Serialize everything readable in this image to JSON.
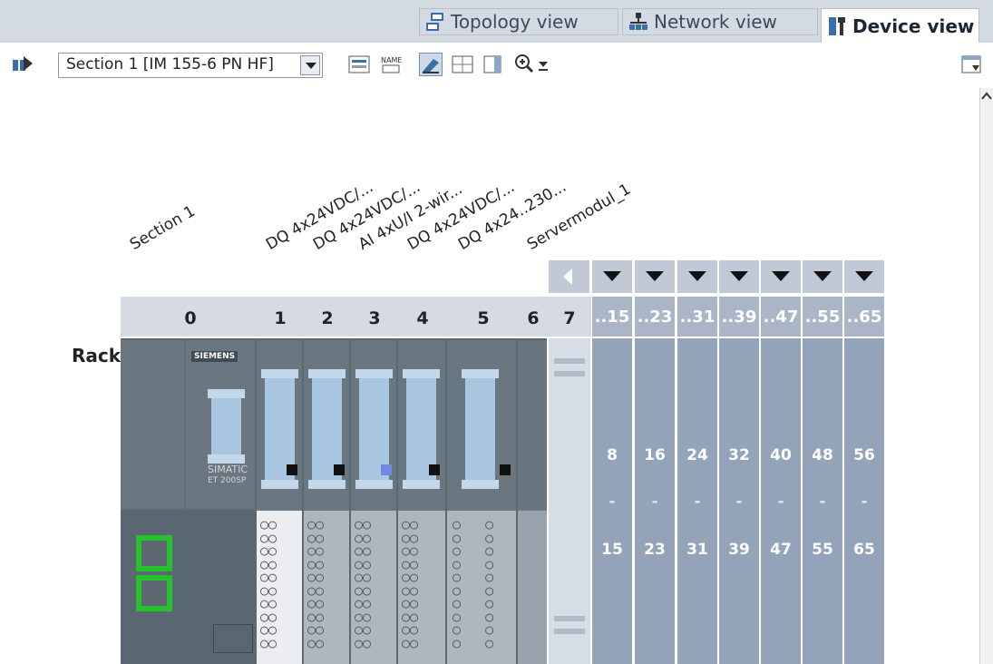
{
  "tabs": [
    {
      "label": "Topology view",
      "icon": "topology-icon",
      "active": false
    },
    {
      "label": "Network view",
      "icon": "network-icon",
      "active": false
    },
    {
      "label": "Device view",
      "icon": "device-icon",
      "active": true
    }
  ],
  "toolbar": {
    "section_select_value": "Section 1 [IM 155-6 PN HF]",
    "name_icon_text": "NAME"
  },
  "modules": [
    {
      "name": "Section 1",
      "slot": "0"
    },
    {
      "name": "DQ 4x24VDC/...",
      "slot": "1"
    },
    {
      "name": "DQ 4x24VDC/...",
      "slot": "2"
    },
    {
      "name": "AI 4xU/I 2-wir...",
      "slot": "3"
    },
    {
      "name": "DQ 4x24VDC/...",
      "slot": "4"
    },
    {
      "name": "DQ 4x24..230...",
      "slot": "5"
    },
    {
      "name": "Servermodul_1",
      "slot": "6"
    }
  ],
  "slot_numbers": [
    "0",
    "1",
    "2",
    "3",
    "4",
    "5",
    "6",
    "7"
  ],
  "rack_label": "Rack",
  "im_module": {
    "brand": "SIEMENS",
    "line1": "SIMATIC",
    "line2": "ET 200SP"
  },
  "expansion": [
    {
      "header": "..15",
      "from": "8",
      "sep": "-",
      "to": "15"
    },
    {
      "header": "..23",
      "from": "16",
      "sep": "-",
      "to": "23"
    },
    {
      "header": "..31",
      "from": "24",
      "sep": "-",
      "to": "31"
    },
    {
      "header": "..39",
      "from": "32",
      "sep": "-",
      "to": "39"
    },
    {
      "header": "..47",
      "from": "40",
      "sep": "-",
      "to": "47"
    },
    {
      "header": "..55",
      "from": "48",
      "sep": "-",
      "to": "55"
    },
    {
      "header": "..65",
      "from": "56",
      "sep": "-",
      "to": "65"
    }
  ],
  "colors": {
    "port_green": "#26c22e",
    "expansion_bg": "#93a3b9",
    "spring_blue": "#a8c6e0"
  }
}
